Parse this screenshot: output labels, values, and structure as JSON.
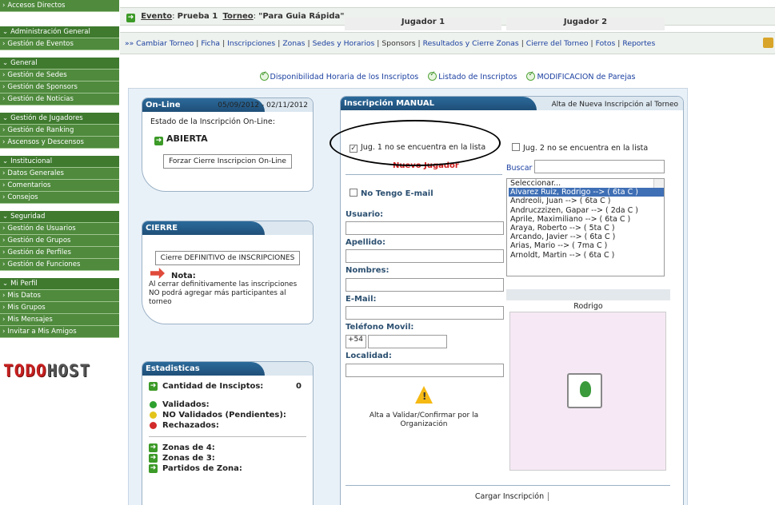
{
  "sidebar": {
    "groups": [
      {
        "items": [
          "Accesos Directos"
        ]
      },
      {
        "items": [
          "Administración General",
          "Gestión de Eventos"
        ]
      },
      {
        "items": [
          "General",
          "Gestión de Sedes",
          "Gestión de Sponsors",
          "Gestión de Noticias"
        ]
      },
      {
        "items": [
          "Gestión de Jugadores",
          "Gestión de Ranking",
          "Ascensos y Descensos"
        ]
      },
      {
        "items": [
          "Institucional",
          "Datos Generales",
          "Comentarios",
          "Consejos"
        ]
      },
      {
        "items": [
          "Seguridad",
          "Gestión de Usuarios",
          "Gestión de Grupos",
          "Gestión de Perfiles",
          "Gestión de Funciones"
        ]
      },
      {
        "items": [
          "Mi Perfil",
          "Mis Datos",
          "Mis Grupos",
          "Mis Mensajes",
          "Invitar a Mis Amigos"
        ]
      }
    ],
    "logo_a": "TODO",
    "logo_b": "HOST"
  },
  "event_bar": {
    "event_label": "Evento",
    "event_value": "Prueba 1",
    "torneo_label": "Torneo",
    "torneo_value": "\"Para Guia Rápida\""
  },
  "menu": {
    "prefix": "»»",
    "links": [
      "Cambiar Torneo",
      "Ficha",
      "Inscripciones",
      "Zonas",
      "Sedes y Horarios",
      "Sponsors",
      "Resultados y Cierre Zonas",
      "Cierre del Torneo",
      "Fotos",
      "Reportes"
    ]
  },
  "actions": [
    "Disponibilidad Horaria de los Inscriptos",
    "Listado de Inscriptos",
    "MODIFICACION de Parejas"
  ],
  "online": {
    "title": "On-Line",
    "dates": "05/09/2012 - 02/11/2012",
    "state_label": "Estado de la Inscripción On-Line:",
    "state_value": "ABIERTA",
    "force_close_button": "Forzar Cierre Inscripcion On-Line"
  },
  "cierre": {
    "title": "CIERRE",
    "button": "Cierre DEFINITIVO de INSCRIPCIONES",
    "nota_title": "Nota:",
    "nota_text": "Al cerrar definitivamente las inscripciones NO podrá agregar más participantes al torneo"
  },
  "stats": {
    "title": "Estadisticas",
    "count_label": "Cantidad de Insciptos:",
    "count_value": "0",
    "validated": "Validados:",
    "pending": "NO Validados (Pendientes):",
    "rejected": "Rechazados:",
    "zones4": "Zonas de 4:",
    "zones3": "Zonas de 3:",
    "zone_matches": "Partidos de Zona:"
  },
  "inscripcion": {
    "title": "Inscripción MANUAL",
    "subtitle": "Alta de Nueva Inscripción al Torneo",
    "player1_header": "Jugador 1",
    "player2_header": "Jugador 2",
    "p1_not_found": "Jug. 1 no se encuentra en la lista",
    "p2_not_found": "Jug. 2 no se encuentra en la lista",
    "new_player": "Nuevo Jugador",
    "search_label": "Buscar",
    "no_email": "No Tengo E-mail",
    "usuario": "Usuario:",
    "apellido": "Apellido:",
    "nombres": "Nombres:",
    "email": "E-Mail:",
    "telefono": "Teléfono Movil:",
    "phone_prefix": "+54",
    "localidad": "Localidad:",
    "validate_note": "Alta a Validar/Confirmar por la Organización",
    "selected_name": "Rodrigo",
    "submit": "Cargar Inscripción",
    "players": [
      "Seleccionar...",
      "Alvarez Ruiz, Rodrigo --> ( 6ta C )",
      "Andreoli, Juan --> ( 6ta C )",
      "Andruczzizen, Gapar --> ( 2da C )",
      "Aprile, Maximiliano --> ( 6ta C )",
      "Araya, Roberto --> ( 5ta C )",
      "Arcando, Javier --> ( 6ta C )",
      "Arias, Mario --> ( 7ma C )",
      "Arnoldt, Martin --> ( 6ta C )"
    ]
  }
}
